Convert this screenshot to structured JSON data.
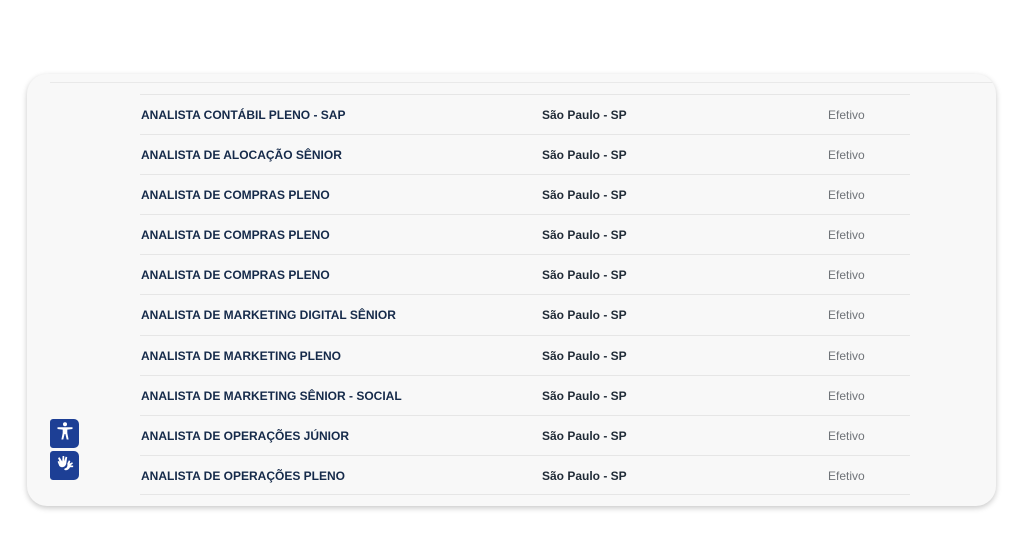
{
  "accent_color": "#1d3f95",
  "jobs": [
    {
      "title": "ANALISTA CONTÁBIL PLENO - SAP",
      "location": "São Paulo - SP",
      "type": "Efetivo"
    },
    {
      "title": "ANALISTA DE ALOCAÇÃO SÊNIOR",
      "location": "São Paulo - SP",
      "type": "Efetivo"
    },
    {
      "title": "ANALISTA DE COMPRAS PLENO",
      "location": "São Paulo - SP",
      "type": "Efetivo"
    },
    {
      "title": "ANALISTA DE COMPRAS PLENO",
      "location": "São Paulo - SP",
      "type": "Efetivo"
    },
    {
      "title": "ANALISTA DE COMPRAS PLENO",
      "location": "São Paulo - SP",
      "type": "Efetivo"
    },
    {
      "title": "ANALISTA DE MARKETING DIGITAL SÊNIOR",
      "location": "São Paulo - SP",
      "type": "Efetivo"
    },
    {
      "title": "ANALISTA DE MARKETING PLENO",
      "location": "São Paulo - SP",
      "type": "Efetivo"
    },
    {
      "title": "ANALISTA DE MARKETING SÊNIOR - SOCIAL",
      "location": "São Paulo - SP",
      "type": "Efetivo"
    },
    {
      "title": "ANALISTA DE OPERAÇÕES JÚNIOR",
      "location": "São Paulo - SP",
      "type": "Efetivo"
    },
    {
      "title": "ANALISTA DE OPERAÇÕES PLENO",
      "location": "São Paulo - SP",
      "type": "Efetivo"
    }
  ],
  "accessibility": {
    "buttons": [
      {
        "icon": "accessibility-person-icon"
      },
      {
        "icon": "sign-language-hands-icon"
      }
    ]
  }
}
